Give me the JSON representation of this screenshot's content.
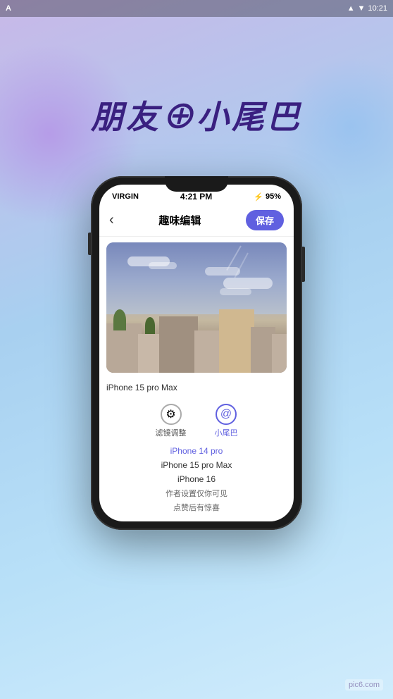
{
  "system": {
    "status_bar": {
      "left": "A",
      "wifi": "▲",
      "battery_icon": "▼",
      "time": "10:21"
    }
  },
  "background": {
    "title": "朋友⊕小尾巴",
    "blob_colors": [
      "#c0a8e8",
      "#90c8f0"
    ]
  },
  "phone": {
    "status": {
      "carrier": "VIRGIN",
      "wifi": "wifi",
      "time": "4:21 PM",
      "bluetooth": "B",
      "battery": "95%"
    },
    "header": {
      "back_label": "‹",
      "title": "趣味编辑",
      "save_label": "保存"
    },
    "photo": {
      "model": "iPhone 15 pro Max"
    },
    "tabs": [
      {
        "id": "filter",
        "icon": "⚙",
        "label": "滤镜调整",
        "active": false
      },
      {
        "id": "tail",
        "icon": "@",
        "label": "小尾巴",
        "active": true
      }
    ],
    "device_list": {
      "items": [
        {
          "text": "iPhone 14 pro",
          "highlighted": true
        },
        {
          "text": "iPhone 15 pro Max",
          "highlighted": false
        },
        {
          "text": "iPhone 16",
          "highlighted": false
        }
      ],
      "sub_items": [
        {
          "text": "作者设置仅你可见"
        },
        {
          "text": "点赞后有惊喜"
        }
      ]
    }
  },
  "watermark": {
    "text": "pic6.com"
  }
}
